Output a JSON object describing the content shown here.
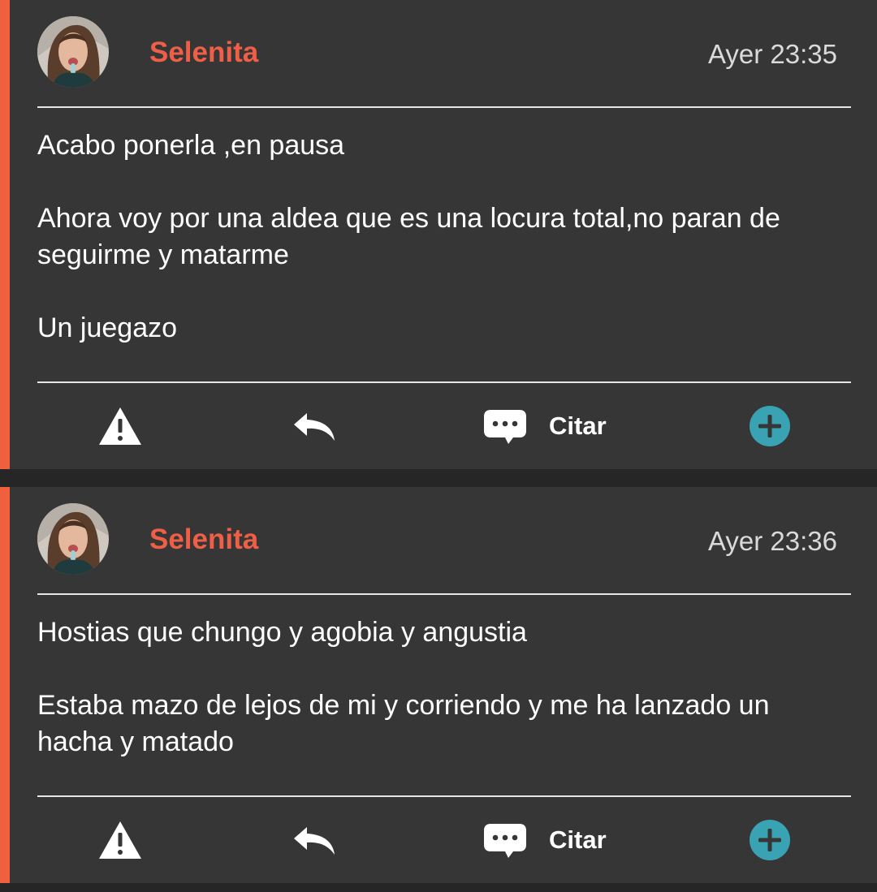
{
  "colors": {
    "accent": "#f0603f",
    "username": "#ef5f48",
    "add_button": "#3aa3b3",
    "card_bg": "#363636",
    "page_bg": "#262626"
  },
  "posts": [
    {
      "username": "Selenita",
      "timestamp": "Ayer 23:35",
      "paragraphs": [
        "Acabo ponerla ,en pausa",
        "Ahora voy por una aldea que es una locura total,no paran de seguirme y matarme",
        "Un juegazo"
      ],
      "actions": {
        "report_icon": "warning-icon",
        "reply_icon": "reply-icon",
        "quote_icon": "chat-bubble-icon",
        "quote_label": "Citar",
        "add_icon": "plus-circle-icon"
      }
    },
    {
      "username": "Selenita",
      "timestamp": "Ayer 23:36",
      "paragraphs": [
        "Hostias que chungo y agobia y angustia",
        "Estaba mazo de lejos de mi y corriendo y me ha lanzado un hacha y matado"
      ],
      "actions": {
        "report_icon": "warning-icon",
        "reply_icon": "reply-icon",
        "quote_icon": "chat-bubble-icon",
        "quote_label": "Citar",
        "add_icon": "plus-circle-icon"
      }
    }
  ]
}
